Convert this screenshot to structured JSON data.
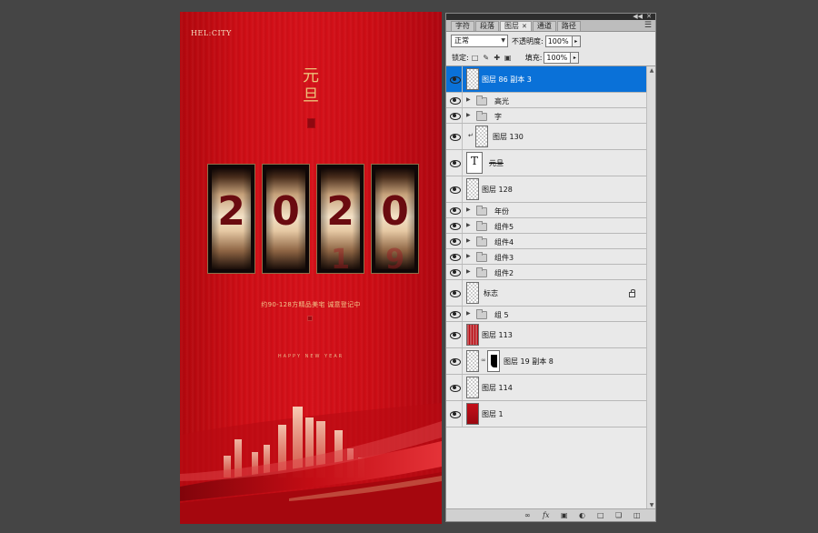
{
  "poster": {
    "brand": "HEL:CITY",
    "title": "元旦",
    "digits": [
      "2",
      "0",
      "2",
      "0"
    ],
    "next_digits": [
      "",
      "",
      "1",
      "9"
    ],
    "subtitle": "约90-128方精品美宅  诚意登记中",
    "tagline": "HAPPY NEW YEAR"
  },
  "panel": {
    "tabs": [
      {
        "label": "字符",
        "active": false
      },
      {
        "label": "段落",
        "active": false
      },
      {
        "label": "图层",
        "active": true
      },
      {
        "label": "通道",
        "active": false
      },
      {
        "label": "路径",
        "active": false
      }
    ],
    "blend_mode": "正常",
    "opacity_label": "不透明度:",
    "opacity_value": "100%",
    "lock_label": "锁定:",
    "fill_label": "填充:",
    "fill_value": "100%",
    "layers": [
      {
        "name": "图层 86 副本 3",
        "kind": "pixel",
        "selected": true
      },
      {
        "name": "高光",
        "kind": "group"
      },
      {
        "name": "字",
        "kind": "group"
      },
      {
        "name": "图层 130",
        "kind": "pixel",
        "clipped": true
      },
      {
        "name": "元旦",
        "kind": "text"
      },
      {
        "name": "图层 128",
        "kind": "pixel"
      },
      {
        "name": "年份",
        "kind": "group"
      },
      {
        "name": "组件5",
        "kind": "group"
      },
      {
        "name": "组件4",
        "kind": "group"
      },
      {
        "name": "组件3",
        "kind": "group"
      },
      {
        "name": "组件2",
        "kind": "group"
      },
      {
        "name": "标志",
        "kind": "pixel",
        "locked": true
      },
      {
        "name": "组 5",
        "kind": "group"
      },
      {
        "name": "图层 113",
        "kind": "pixel-red-stripe"
      },
      {
        "name": "图层 19 副本 8",
        "kind": "masked"
      },
      {
        "name": "图层 114",
        "kind": "pixel"
      },
      {
        "name": "图层 1",
        "kind": "pixel-red"
      }
    ],
    "bottom_icons": [
      "link-icon",
      "fx-icon",
      "mask-icon",
      "adjustment-icon",
      "new-group-icon",
      "new-layer-icon",
      "trash-icon"
    ]
  }
}
